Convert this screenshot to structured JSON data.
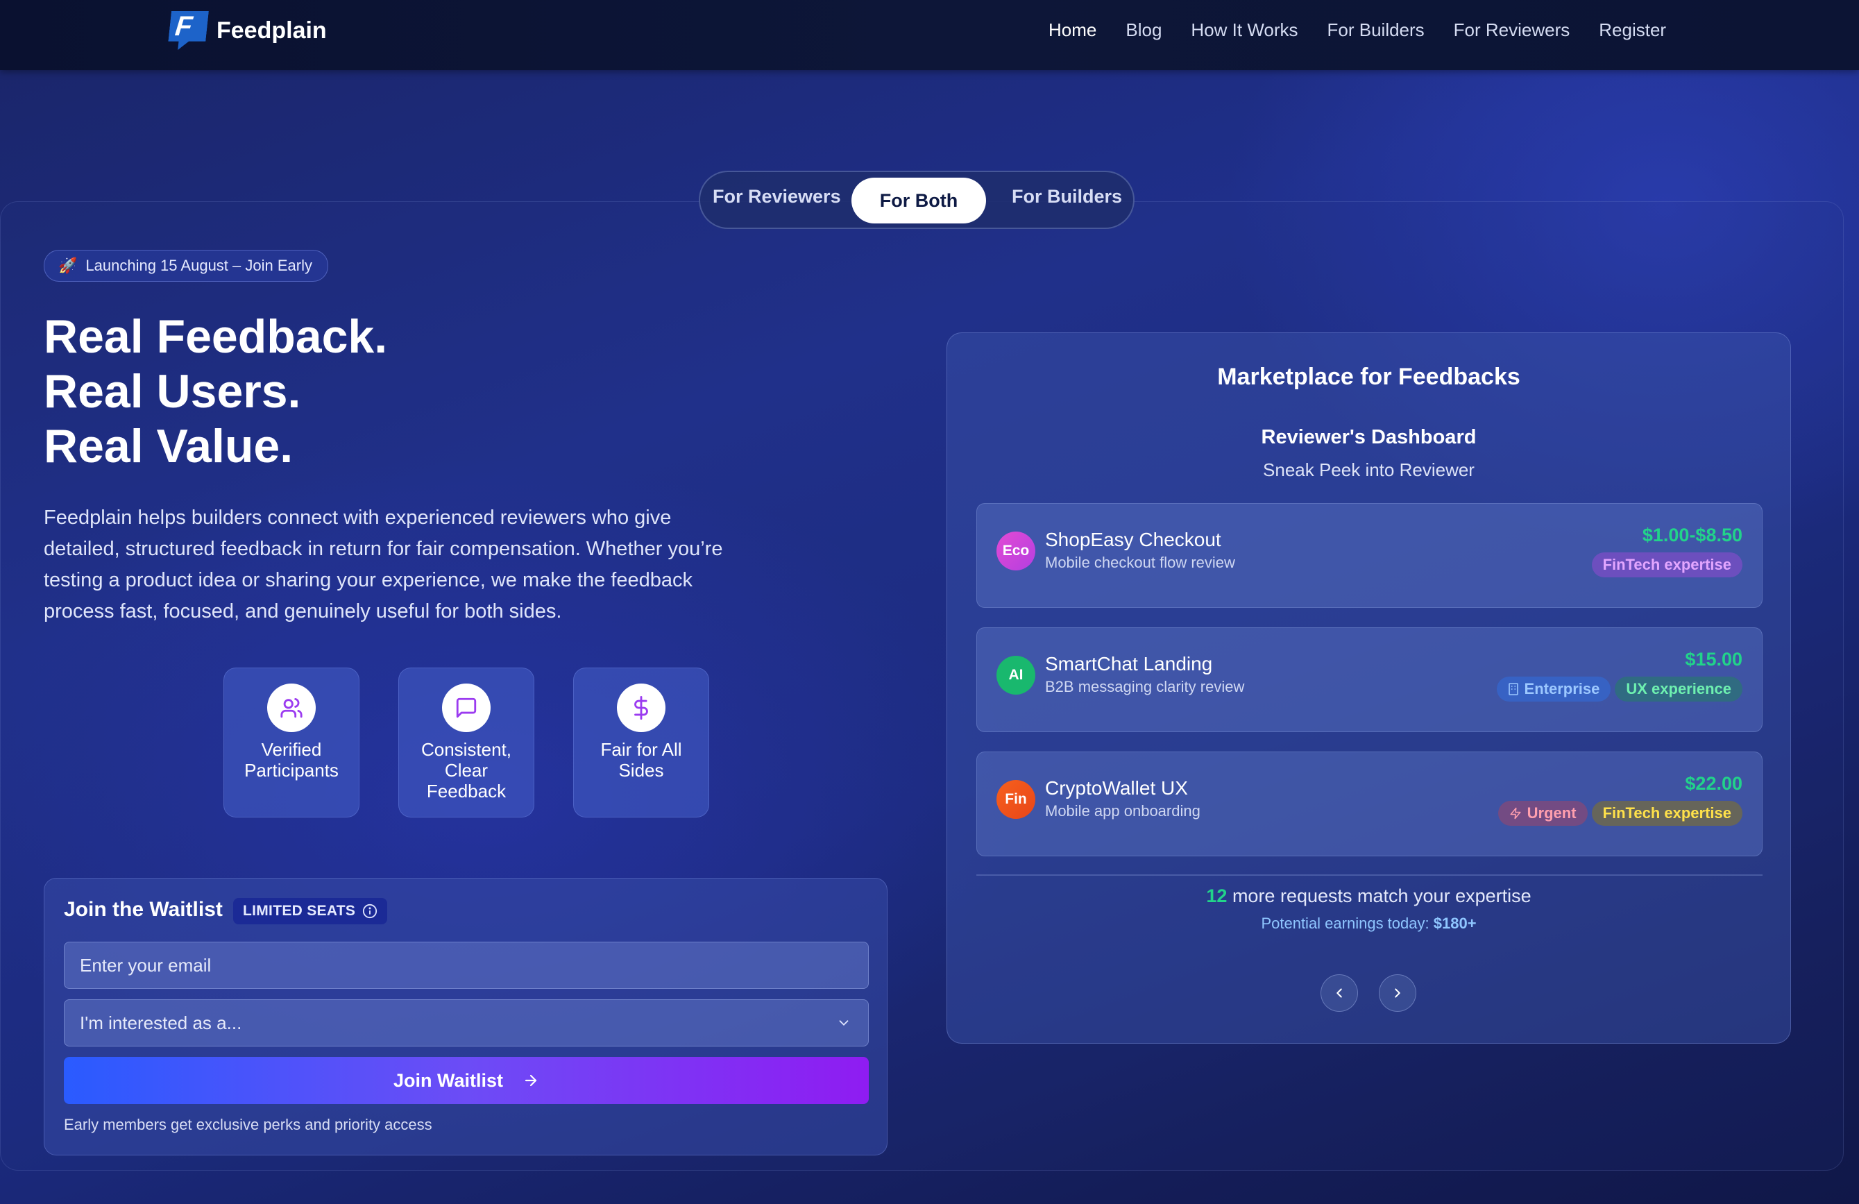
{
  "brand": {
    "name": "Feedplain",
    "logo_letter": "F"
  },
  "nav": {
    "items": [
      {
        "label": "Home",
        "active": true
      },
      {
        "label": "Blog",
        "active": false
      },
      {
        "label": "How It Works",
        "active": false
      },
      {
        "label": "For Builders",
        "active": false
      },
      {
        "label": "For Reviewers",
        "active": false
      },
      {
        "label": "Register",
        "active": false
      }
    ]
  },
  "audience_toggle": {
    "options": [
      "For Reviewers",
      "For Both",
      "For Builders"
    ],
    "selected": "For Both"
  },
  "hero": {
    "badge": "Launching 15 August – Join Early",
    "badge_icon": "rocket-icon",
    "headline": [
      "Real Feedback.",
      "Real Users.",
      "Real Value."
    ],
    "description": "Feedplain helps builders connect with experienced reviewers who give detailed, structured feedback in return for fair compensation. Whether you’re testing a product idea or sharing your experience, we make the feedback process fast, focused, and genuinely useful for both sides."
  },
  "features": [
    {
      "label": "Verified Participants",
      "icon": "users-icon"
    },
    {
      "label": "Consistent, Clear Feedback",
      "icon": "message-square-icon"
    },
    {
      "label": "Fair for All Sides",
      "icon": "dollar-icon"
    }
  ],
  "waitlist": {
    "title": "Join the Waitlist",
    "seats_badge": "LIMITED SEATS",
    "email_placeholder": "Enter your email",
    "role_select_value": "I'm interested as a...",
    "submit_label": "Join Waitlist",
    "note": "Early members get exclusive perks and priority access"
  },
  "marketplace": {
    "title": "Marketplace for Feedbacks",
    "dashboard_title": "Reviewer's Dashboard",
    "dashboard_subtitle": "Sneak Peek into Reviewer",
    "requests": [
      {
        "avatar": "Eco",
        "avatar_color": "#d63fd0",
        "name": "ShopEasy Checkout",
        "subtitle": "Mobile checkout flow review",
        "price": "$1.00-$8.50",
        "tags": [
          {
            "label": "FinTech expertise",
            "kind": "fin"
          }
        ]
      },
      {
        "avatar": "AI",
        "avatar_color": "#19b86e",
        "name": "SmartChat Landing",
        "subtitle": "B2B messaging clarity review",
        "price": "$15.00",
        "tags": [
          {
            "label": "Enterprise",
            "kind": "ent",
            "icon": "building-icon"
          },
          {
            "label": "UX experience",
            "kind": "ux"
          }
        ]
      },
      {
        "avatar": "Fin",
        "avatar_color": "#f2541b",
        "name": "CryptoWallet UX",
        "subtitle": "Mobile app onboarding",
        "price": "$22.00",
        "tags": [
          {
            "label": "Urgent",
            "kind": "urg",
            "icon": "lightning-icon"
          },
          {
            "label": "FinTech expertise",
            "kind": "fin2"
          }
        ]
      }
    ],
    "more_count": "12",
    "more_text": "more requests match your expertise",
    "earnings_label": "Potential earnings today:",
    "earnings_value": "$180+"
  },
  "colors": {
    "accent_green": "#22d38a",
    "button_gradient_start": "#2a5bff",
    "button_gradient_end": "#8f1cf2",
    "background": "#1f2f8a"
  }
}
